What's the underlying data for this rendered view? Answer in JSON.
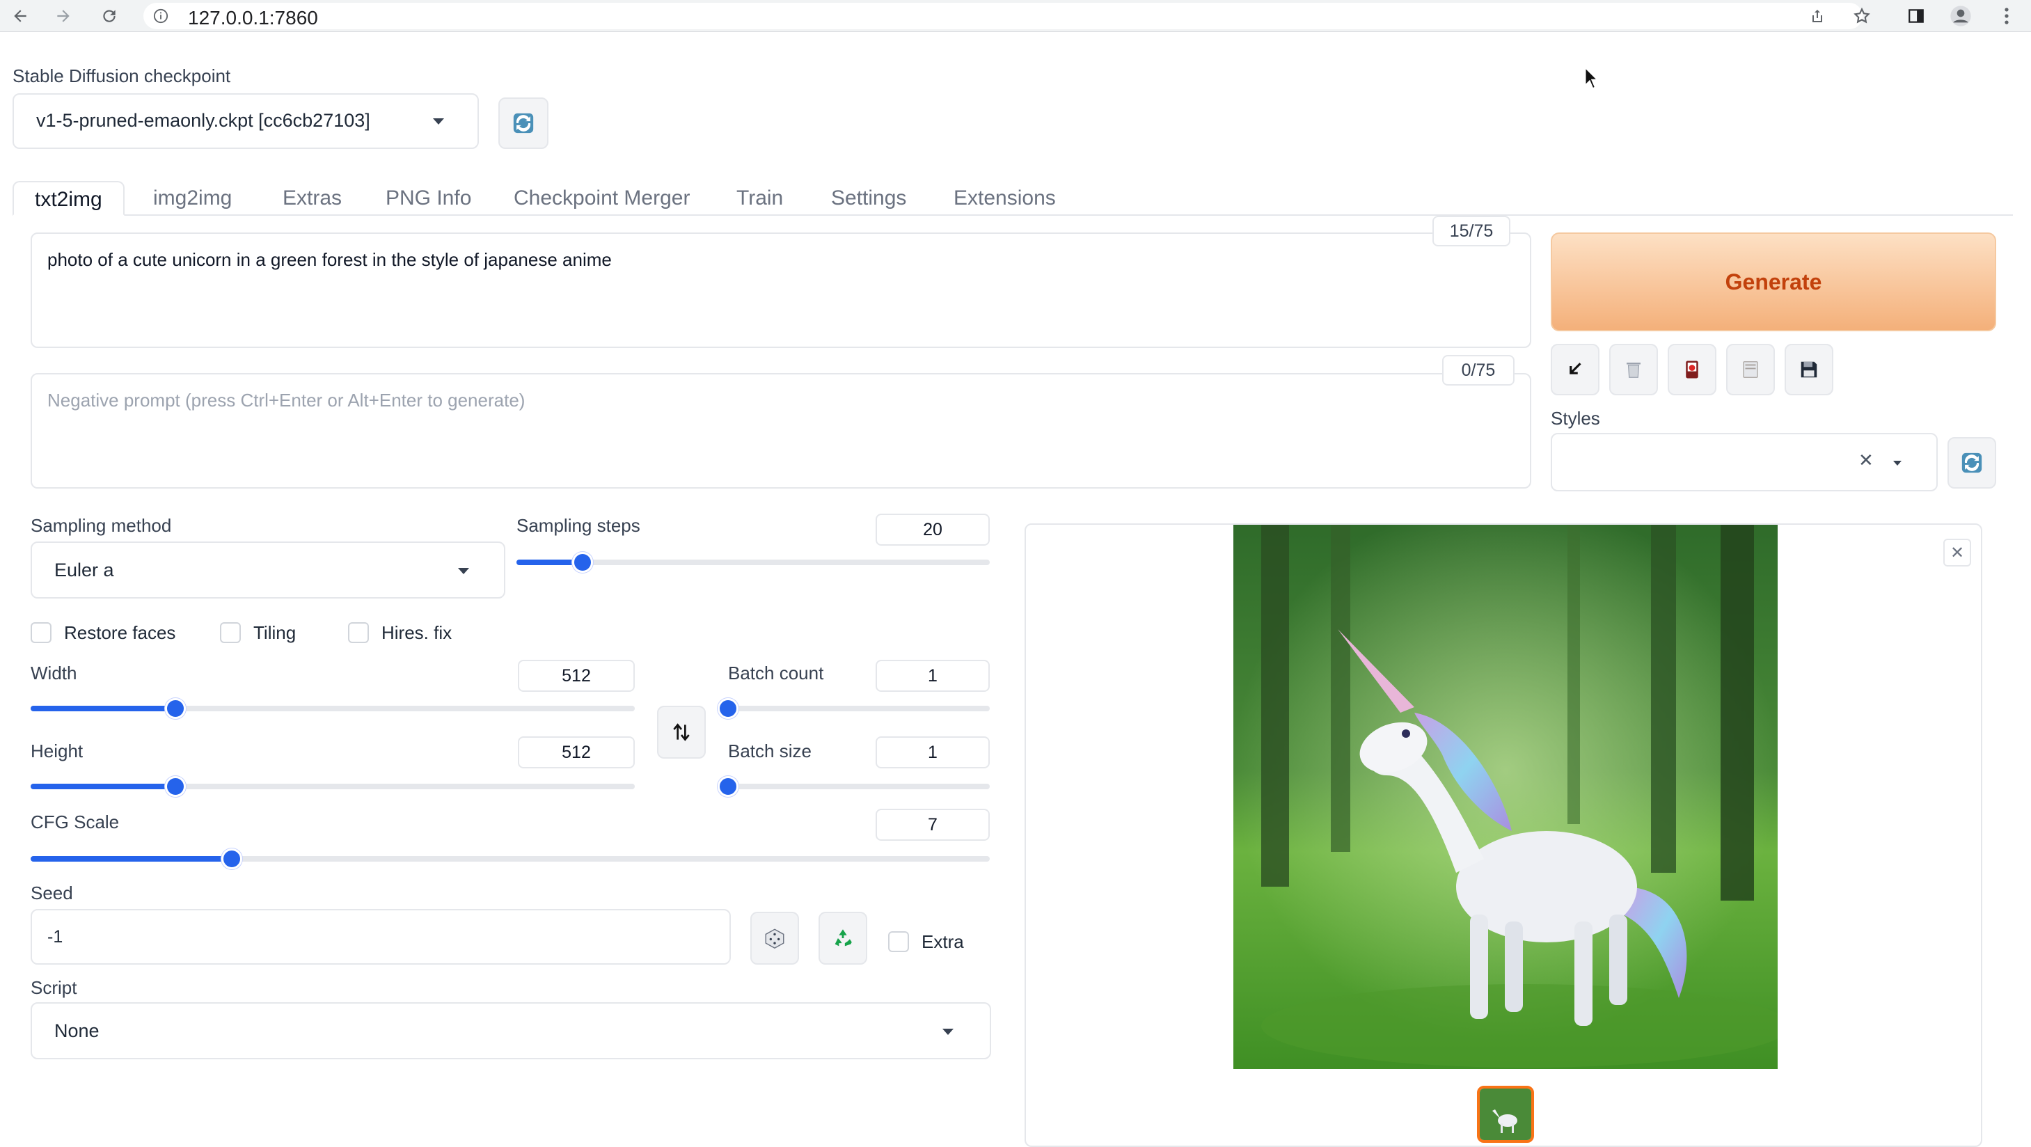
{
  "browser": {
    "url": "127.0.0.1:7860"
  },
  "checkpoint": {
    "label": "Stable Diffusion checkpoint",
    "value": "v1-5-pruned-emaonly.ckpt [cc6cb27103]"
  },
  "tabs": [
    {
      "label": "txt2img",
      "active": true
    },
    {
      "label": "img2img"
    },
    {
      "label": "Extras"
    },
    {
      "label": "PNG Info"
    },
    {
      "label": "Checkpoint Merger"
    },
    {
      "label": "Train"
    },
    {
      "label": "Settings"
    },
    {
      "label": "Extensions"
    }
  ],
  "prompt": {
    "text": "photo of a cute unicorn in a green forest in the style of japanese anime",
    "token_count": "15/75"
  },
  "negative_prompt": {
    "placeholder": "Negative prompt (press Ctrl+Enter or Alt+Enter to generate)",
    "token_count": "0/75"
  },
  "generate_label": "Generate",
  "styles": {
    "label": "Styles"
  },
  "sampling_method": {
    "label": "Sampling method",
    "value": "Euler a"
  },
  "sampling_steps": {
    "label": "Sampling steps",
    "value": "20",
    "fraction": 0.14
  },
  "checkboxes": {
    "restore_faces": "Restore faces",
    "tiling": "Tiling",
    "hires_fix": "Hires. fix"
  },
  "width": {
    "label": "Width",
    "value": "512",
    "fraction": 0.24
  },
  "height": {
    "label": "Height",
    "value": "512",
    "fraction": 0.24
  },
  "batch_count": {
    "label": "Batch count",
    "value": "1",
    "fraction": 0.0
  },
  "batch_size": {
    "label": "Batch size",
    "value": "1",
    "fraction": 0.0
  },
  "cfg_scale": {
    "label": "CFG Scale",
    "value": "7",
    "fraction": 0.21
  },
  "seed": {
    "label": "Seed",
    "value": "-1",
    "extra_label": "Extra"
  },
  "script": {
    "label": "Script",
    "value": "None"
  },
  "colors": {
    "accent": "#2563eb",
    "generate_text": "#c2410c"
  }
}
